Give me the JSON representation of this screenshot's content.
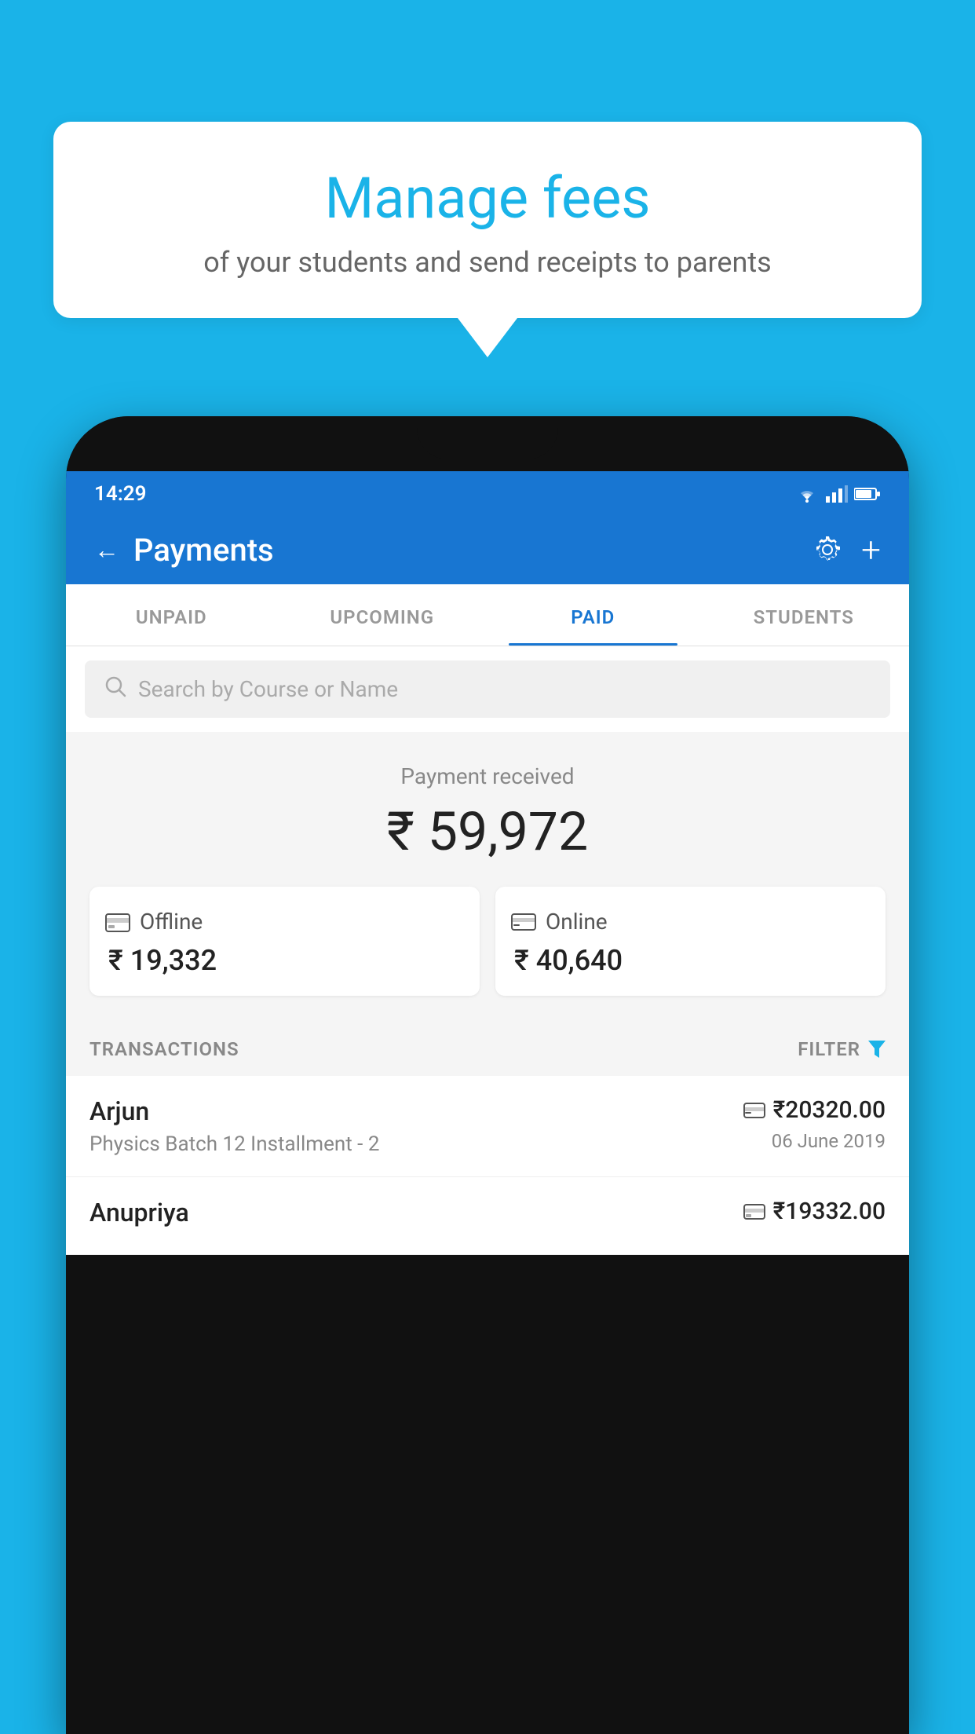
{
  "background_color": "#1ab3e8",
  "speech_bubble": {
    "title": "Manage fees",
    "subtitle": "of your students and send receipts to parents"
  },
  "status_bar": {
    "time": "14:29",
    "wifi": "▼",
    "signal": "▲",
    "battery": "▮"
  },
  "app_header": {
    "title": "Payments",
    "back_label": "←",
    "gear_label": "⚙",
    "plus_label": "+"
  },
  "tabs": [
    {
      "label": "UNPAID",
      "active": false
    },
    {
      "label": "UPCOMING",
      "active": false
    },
    {
      "label": "PAID",
      "active": true
    },
    {
      "label": "STUDENTS",
      "active": false
    }
  ],
  "search": {
    "placeholder": "Search by Course or Name"
  },
  "payment_summary": {
    "label": "Payment received",
    "total_amount": "₹ 59,972",
    "offline_label": "Offline",
    "offline_amount": "₹ 19,332",
    "online_label": "Online",
    "online_amount": "₹ 40,640"
  },
  "transactions": {
    "header_label": "TRANSACTIONS",
    "filter_label": "FILTER",
    "rows": [
      {
        "name": "Arjun",
        "course": "Physics Batch 12 Installment - 2",
        "payment_icon": "card",
        "amount": "₹20320.00",
        "date": "06 June 2019"
      },
      {
        "name": "Anupriya",
        "course": "",
        "payment_icon": "offline",
        "amount": "₹19332.00",
        "date": ""
      }
    ]
  }
}
